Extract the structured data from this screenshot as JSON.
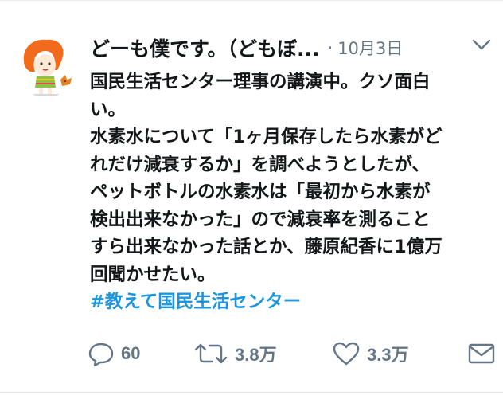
{
  "tweet": {
    "author": {
      "display_name": "どーも僕です。（どもぼ...",
      "avatar_icon": "illustrated-character-avatar"
    },
    "meta_separator": "·",
    "timestamp": "10月3日",
    "menu_icon": "chevron-down-icon",
    "text_lines": [
      "国民生活センター理事の講演中。クソ面白",
      "い。",
      "水素水について「1ヶ月保存したら水素がど",
      "れだけ減衰するか」を調べようとしたが、",
      "ペットボトルの水素水は「最初から水素が",
      "検出出来なかった」ので減衰率を測ること",
      "すら出来なかった話とか、藤原紀香に1億万",
      "回聞かせたい。"
    ],
    "hashtag": "#教えて国民生活センター",
    "actions": {
      "reply": {
        "icon": "reply-icon",
        "count": "60"
      },
      "retweet": {
        "icon": "retweet-icon",
        "count": "3.8万"
      },
      "like": {
        "icon": "heart-icon",
        "count": "3.3万"
      },
      "dm": {
        "icon": "envelope-icon"
      }
    }
  },
  "colors": {
    "text": "#14171a",
    "secondary": "#657786",
    "link": "#1b95e0",
    "border": "#e1e8ed"
  }
}
